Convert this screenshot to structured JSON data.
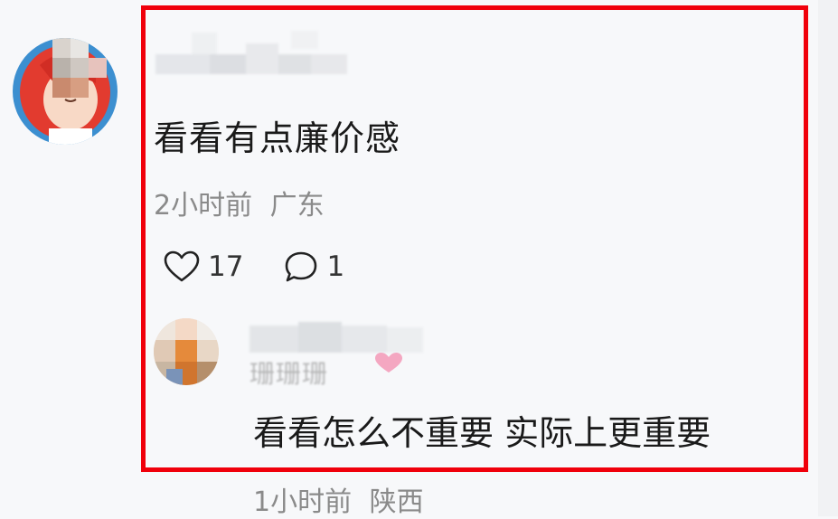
{
  "comment": {
    "text": "看看有点廉价感",
    "time": "2小时前",
    "location": "广东",
    "likes": "17",
    "replies": "1",
    "like_icon": "heart-outline-icon",
    "reply_icon": "speech-bubble-icon"
  },
  "reply": {
    "name_fragment": "珊珊珊",
    "text": "看看怎么不重要 实际上更重要",
    "time": "1小时前",
    "location": "陕西"
  },
  "colors": {
    "highlight": "#f0000b",
    "meta_text": "#8a8a8a",
    "background": "#f7f8fa"
  }
}
